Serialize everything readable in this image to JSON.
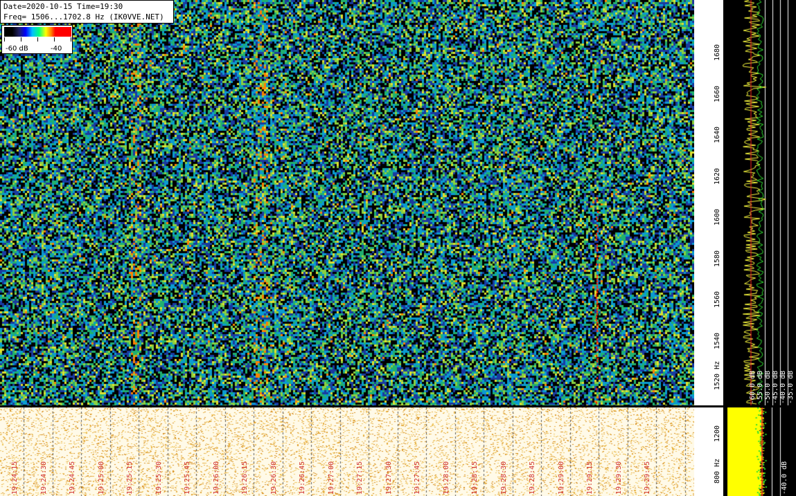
{
  "header": {
    "line1": "Date=2020-10-15 Time=19:30",
    "line2": "Freq= 1506...1702.8 Hz (IK0VVE.NET)"
  },
  "colorbar": {
    "low_label": "-60 dB",
    "high_label": "-40"
  },
  "freq_scale": {
    "labels": [
      "1680",
      "1660",
      "1640",
      "1620",
      "1600",
      "1580",
      "1560",
      "1540",
      "1520 Hz"
    ]
  },
  "bottom_freq_scale": {
    "labels": [
      "1200",
      "800 Hz"
    ]
  },
  "db_scale": {
    "labels": [
      "-35.0 dB",
      "-40.0 dB",
      "-45.0 dB",
      "-50.0 dB",
      "-55.0 dB",
      "-60.0 dB"
    ]
  },
  "bottom_db_scale": {
    "labels": [
      "-40.0 dB"
    ]
  },
  "time_axis": {
    "labels": [
      "19:24:15",
      "19:24:30",
      "19:24:45",
      "19:25:00",
      "19:25:15",
      "19:25:30",
      "19:25:45",
      "19:26:00",
      "19:26:15",
      "19:26:30",
      "19:26:45",
      "19:27:00",
      "19:27:15",
      "19:27:30",
      "19:27:45",
      "19:28:00",
      "19:28:15",
      "19:28:30",
      "19:28:45",
      "19:29:00",
      "19:29:15",
      "19:29:30",
      "19:29:45"
    ]
  },
  "colors": {
    "palette": [
      "#000000",
      "#1a3aa0",
      "#0a9bd0",
      "#20b070",
      "#8ad040",
      "#e0e030",
      "#ff8000",
      "#ff2000"
    ],
    "bottom_bg": "#fffae8",
    "bottom_dots": [
      "#e8b040",
      "#f0c860",
      "#d89020"
    ],
    "trace_yellow": "#ffff40",
    "trace_green": "#30e030",
    "trace_red": "#ff2020"
  }
}
